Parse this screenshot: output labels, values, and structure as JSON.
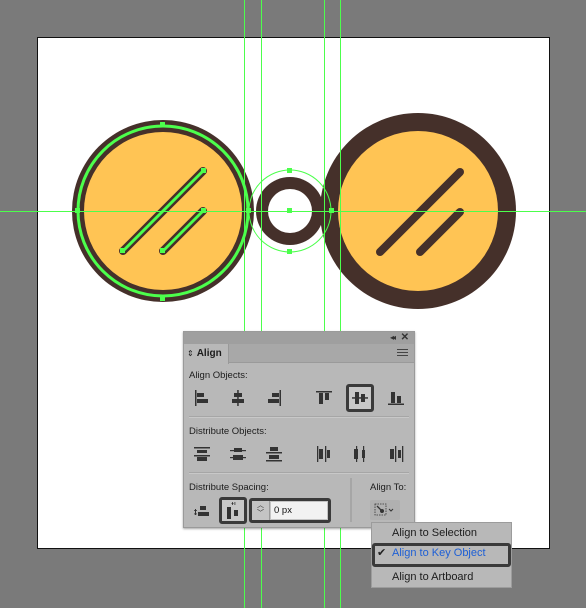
{
  "colors": {
    "canvas_bg": "#7a7a7a",
    "artboard_bg": "#ffffff",
    "guide": "#4cff4c",
    "glass_fill": "#ffc454",
    "glass_stroke": "#45302a",
    "selection": "#4cff4c",
    "panel_bg": "#b8b8b8",
    "highlight": "#3a3a3a",
    "active_text": "#1d5fd6"
  },
  "panel": {
    "title": "Align",
    "collapse_icon": "double-chevron-left",
    "close_icon": "close-x",
    "menu_icon": "hamburger",
    "align_objects": {
      "label": "Align Objects:",
      "buttons": [
        {
          "name": "horizontal-align-left",
          "selected": false
        },
        {
          "name": "horizontal-align-center",
          "selected": false
        },
        {
          "name": "horizontal-align-right",
          "selected": false
        },
        {
          "name": "vertical-align-top",
          "selected": false
        },
        {
          "name": "vertical-align-center",
          "selected": true
        },
        {
          "name": "vertical-align-bottom",
          "selected": false
        }
      ]
    },
    "distribute_objects": {
      "label": "Distribute Objects:",
      "buttons": [
        {
          "name": "vertical-distribute-top"
        },
        {
          "name": "vertical-distribute-center"
        },
        {
          "name": "vertical-distribute-bottom"
        },
        {
          "name": "horizontal-distribute-left"
        },
        {
          "name": "horizontal-distribute-center"
        },
        {
          "name": "horizontal-distribute-right"
        }
      ]
    },
    "distribute_spacing": {
      "label": "Distribute Spacing:",
      "buttons": [
        {
          "name": "vertical-distribute-space",
          "selected": false
        },
        {
          "name": "horizontal-distribute-space",
          "selected": true
        }
      ],
      "value": "0 px"
    },
    "align_to": {
      "label": "Align To:"
    }
  },
  "dropdown": {
    "items": [
      {
        "label": "Align to Selection",
        "checked": false
      },
      {
        "label": "Align to Key Object",
        "checked": true
      },
      {
        "label": "Align to Artboard",
        "checked": false
      }
    ],
    "check_glyph": "✔"
  }
}
